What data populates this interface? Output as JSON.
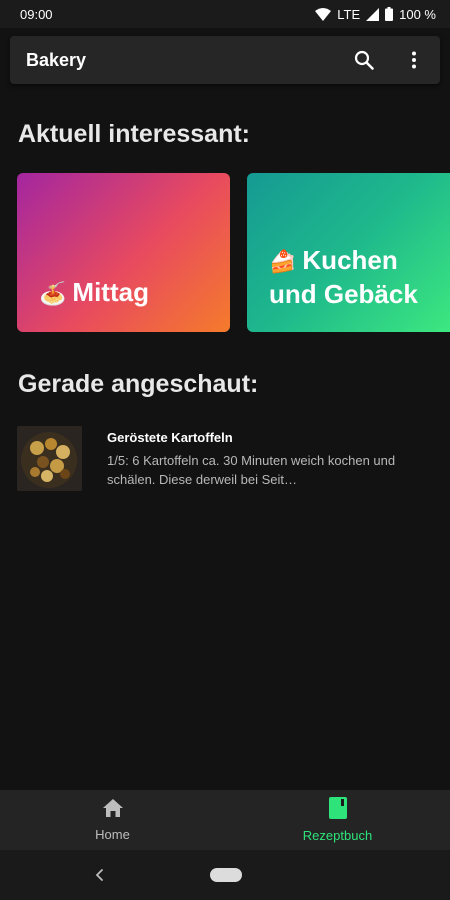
{
  "status_bar": {
    "time": "09:00",
    "network": "LTE",
    "battery": "100 %"
  },
  "app_bar": {
    "title": "Bakery",
    "search_icon": "search-icon",
    "more_icon": "more-vert-icon"
  },
  "sections": {
    "featured_title": "Aktuell interessant:",
    "recent_title": "Gerade angeschaut:"
  },
  "cards": [
    {
      "emoji": "🍝",
      "label": "Mittag",
      "color_start": "#a326a0",
      "color_end": "#f57b2b"
    },
    {
      "emoji": "🍰",
      "label": "Kuchen und Gebäck",
      "color_start": "#159a93",
      "color_end": "#3de87f"
    }
  ],
  "recent": [
    {
      "title": "Geröstete Kartoffeln",
      "description": "1/5: 6 Kartoffeln ca. 30 Minuten weich kochen und schälen. Diese derweil bei Seit…"
    }
  ],
  "bottom_nav": [
    {
      "label": "Home",
      "icon": "home-icon",
      "active": false
    },
    {
      "label": "Rezeptbuch",
      "icon": "book-icon",
      "active": true,
      "active_color": "#2ee47a"
    }
  ]
}
